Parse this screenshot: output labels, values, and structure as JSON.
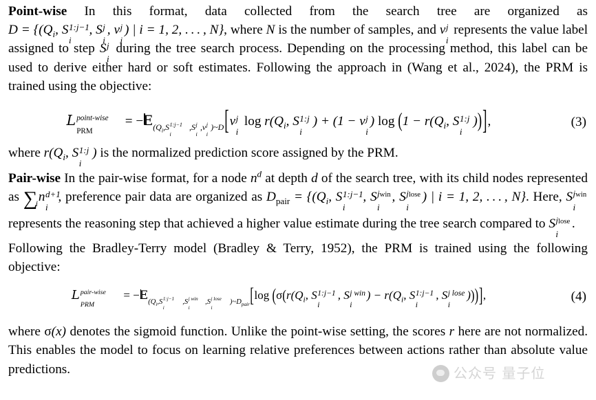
{
  "document": {
    "type": "academic-paper-page",
    "background_color": "#ffffff",
    "text_color": "#000000"
  },
  "sections": {
    "point_wise": {
      "lead": "Point-wise",
      "body_part_1": " In this format, data collected from the search tree are organized as ",
      "math_D_set": "D = {(Q_i, S_i^{1:j-1}, S_i^j, v_i^j) | i = 1, 2, ..., N}",
      "body_part_2": ", where ",
      "math_N": "N",
      "body_part_3": " is the number of samples, and ",
      "math_v": "v_i^j",
      "body_part_4": " represents the value label assigned to step ",
      "math_S": "S_i^j",
      "body_part_5": " during the tree search process. Depending on the processing method, this label can be used to derive either hard or soft estimates. Following the approach in (Wang et al., 2024), the PRM is trained using the objective:"
    },
    "equation_3": {
      "number": "(3)",
      "lhs": "L_PRM^{point-wise}",
      "rhs": "= -E_{(Q_i, S_i^{1:j-1}, S_i^j, v_i^j) ~ D} [ v_i^j log r(Q_i, S_i^{1:j}) + (1 - v_i^j) log (1 - r(Q_i, S_i^{1:j})) ],",
      "label_L": "L",
      "label_sub": "PRM",
      "label_sup": "point-wise"
    },
    "after_eq3": {
      "text_1": "where ",
      "math": "r(Q_i, S_i^{1:j})",
      "text_2": " is the normalized prediction score assigned by the PRM."
    },
    "pair_wise": {
      "lead": "Pair-wise",
      "body_part_1": " In the pair-wise format, for a node ",
      "math_n_d": "n^d",
      "body_part_2": " at depth ",
      "math_d": "d",
      "body_part_3": " of the search tree, with its child nodes represented as ",
      "math_sum": "sum_i n_i^{d+1}",
      "body_part_4": ", preference pair data are organized as ",
      "math_Dpair": "D_pair = {(Q_i, S_i^{1:j-1}, S_i^{j_win}, S_i^{j_lose}) | i = 1, 2, ..., N}",
      "body_part_5": ". Here, ",
      "math_Swin": "S_i^{j_win}",
      "body_part_6": " represents the reasoning step that achieved a higher value estimate during the tree search compared to ",
      "math_Slose": "S_i^{j_lose}",
      "body_part_7": "."
    },
    "bradley_terry": {
      "text": "Following the Bradley-Terry model (Bradley & Terry, 1952), the PRM is trained using the following objective:"
    },
    "equation_4": {
      "number": "(4)",
      "lhs": "L_PRM^{pair-wise}",
      "rhs": "= -E_{(Q_i, S_i^{1:j-1}, S_i^{j win}, S_i^{j lose}) ~ D_pair} [ log ( sigma ( r(Q_i, S_i^{1:j-1}, S_i^{j win}) - r(Q_i, S_i^{1:j-1}, S_i^{j lose}) ) ) ],",
      "label_L": "L",
      "label_sub": "PRM",
      "label_sup": "pair-wise"
    },
    "after_eq4": {
      "text_1": "where ",
      "math_sigma": "σ(x)",
      "text_2": " denotes the sigmoid function. Unlike the point-wise setting, the scores ",
      "math_r": "r",
      "text_3": " here are not normalized. This enables the model to focus on learning relative preferences between actions rather than absolute value predictions."
    }
  },
  "watermark": {
    "text": "公众号 量子位",
    "color": "#9a9a9a",
    "logo_icon": "chat-bubble-avatar-icon"
  }
}
